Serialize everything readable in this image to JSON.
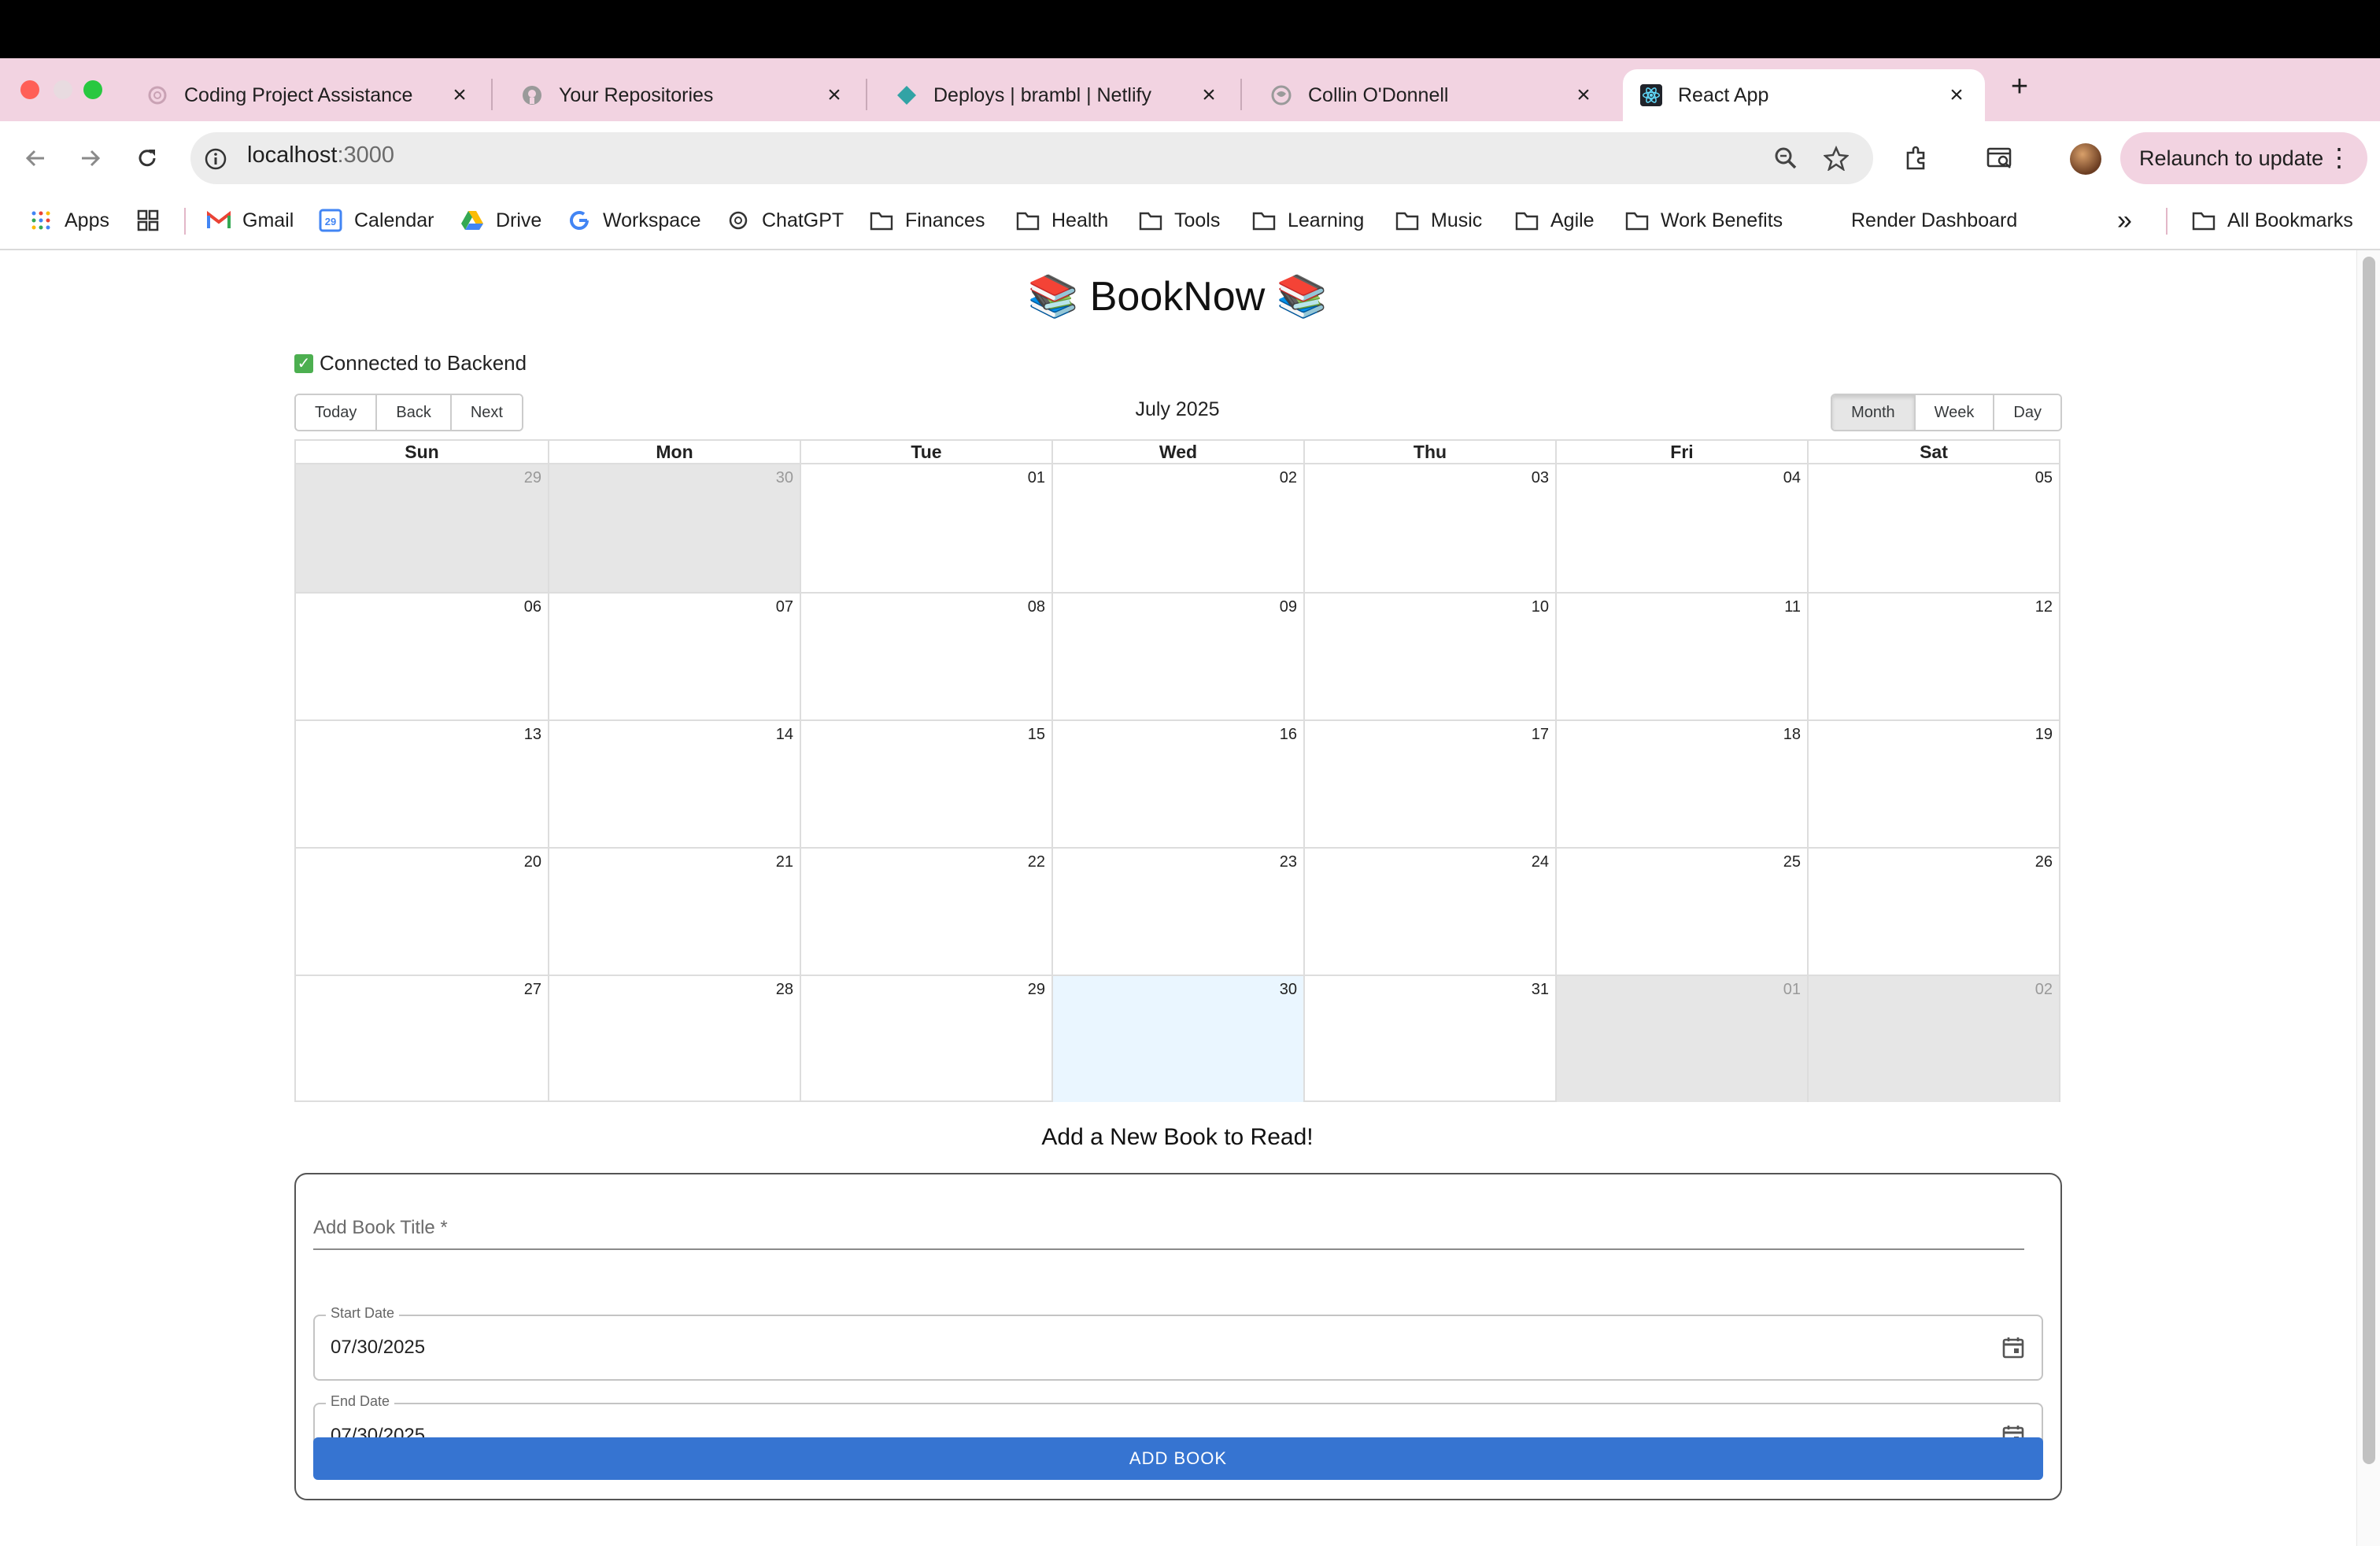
{
  "browser": {
    "tabs": [
      {
        "title": "Coding Project Assistance",
        "icon": "openai-icon"
      },
      {
        "title": "Your Repositories",
        "icon": "github-icon"
      },
      {
        "title": "Deploys | brambl | Netlify",
        "icon": "netlify-icon"
      },
      {
        "title": "Collin O'Donnell",
        "icon": "globe-icon"
      },
      {
        "title": "React App",
        "icon": "react-icon",
        "active": true
      }
    ],
    "url_host": "localhost",
    "url_port": ":3000",
    "relaunch_label": "Relaunch to update",
    "bookmarks": [
      {
        "label": "Apps",
        "icon": "apps-grid-icon"
      },
      {
        "label": "Gmail",
        "icon": "gmail-icon"
      },
      {
        "label": "Calendar",
        "icon": "calendar-icon"
      },
      {
        "label": "Drive",
        "icon": "drive-icon"
      },
      {
        "label": "Workspace",
        "icon": "google-icon"
      },
      {
        "label": "ChatGPT",
        "icon": "openai-icon"
      },
      {
        "label": "Finances",
        "icon": "folder-icon"
      },
      {
        "label": "Health",
        "icon": "folder-icon"
      },
      {
        "label": "Tools",
        "icon": "folder-icon"
      },
      {
        "label": "Learning",
        "icon": "folder-icon"
      },
      {
        "label": "Music",
        "icon": "folder-icon"
      },
      {
        "label": "Agile",
        "icon": "folder-icon"
      },
      {
        "label": "Work Benefits",
        "icon": "folder-icon"
      },
      {
        "label": "Render Dashboard",
        "icon": "none"
      }
    ],
    "overflow_label": "»",
    "all_bookmarks_label": "All Bookmarks"
  },
  "app": {
    "title": "📚 BookNow 📚",
    "status": "Connected to Backend",
    "toolbar": {
      "today": "Today",
      "back": "Back",
      "next": "Next",
      "label": "July 2025",
      "views": [
        "Month",
        "Week",
        "Day"
      ],
      "active_view": "Month"
    },
    "calendar": {
      "weekdays": [
        "Sun",
        "Mon",
        "Tue",
        "Wed",
        "Thu",
        "Fri",
        "Sat"
      ],
      "weeks": [
        [
          "29",
          "30",
          "01",
          "02",
          "03",
          "04",
          "05"
        ],
        [
          "06",
          "07",
          "08",
          "09",
          "10",
          "11",
          "12"
        ],
        [
          "13",
          "14",
          "15",
          "16",
          "17",
          "18",
          "19"
        ],
        [
          "20",
          "21",
          "22",
          "23",
          "24",
          "25",
          "26"
        ],
        [
          "27",
          "28",
          "29",
          "30",
          "31",
          "01",
          "02"
        ]
      ],
      "off_range_cells": [
        [
          0,
          0
        ],
        [
          0,
          1
        ],
        [
          4,
          5
        ],
        [
          4,
          6
        ]
      ],
      "today_cell": [
        4,
        3
      ]
    },
    "form": {
      "heading": "Add a New Book to Read!",
      "title_label": "Add Book Title *",
      "start_label": "Start Date",
      "start_value": "07/30/2025",
      "end_label": "End Date",
      "end_value": "07/30/2025",
      "submit_label": "ADD BOOK"
    }
  },
  "colors": {
    "tabstrip": "#f2d3e1",
    "accent_button": "#3674d1",
    "today_cell": "#eaf6ff",
    "off_range_cell": "#e6e6e6"
  }
}
